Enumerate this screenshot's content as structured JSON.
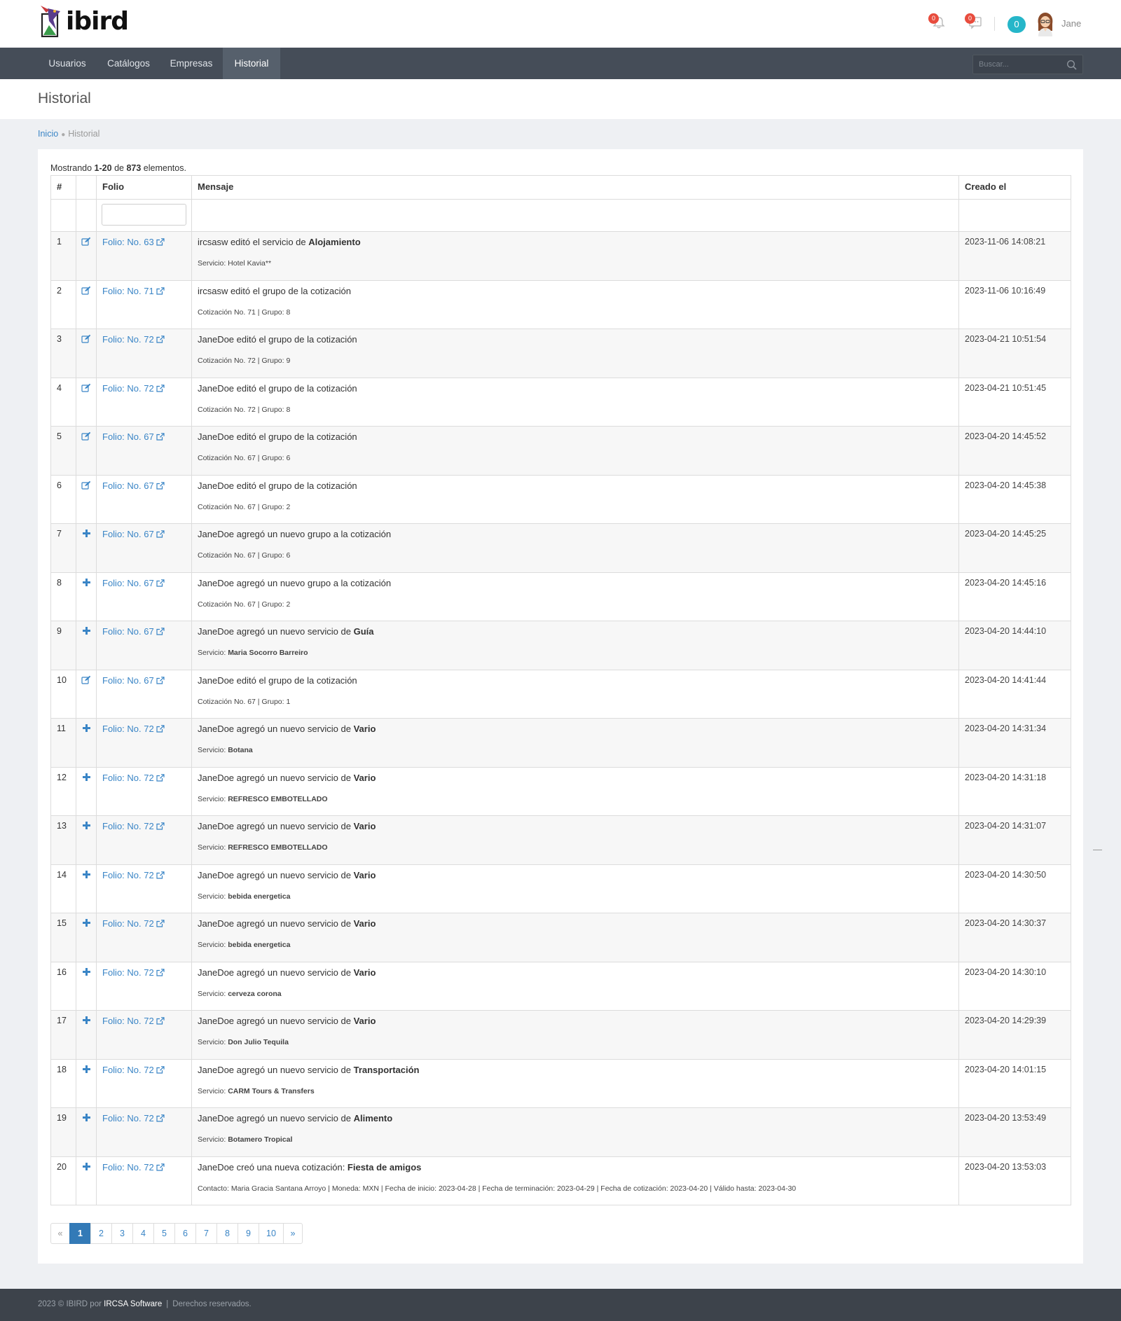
{
  "brand": {
    "logo_text": "ibird"
  },
  "header": {
    "notifications_count": "0",
    "messages_count": "0",
    "counter_badge": "0",
    "user_name": "Jane"
  },
  "nav": {
    "items": [
      {
        "label": "Usuarios"
      },
      {
        "label": "Catálogos"
      },
      {
        "label": "Empresas"
      },
      {
        "label": "Historial",
        "active": true
      }
    ],
    "search_placeholder": "Buscar..."
  },
  "page": {
    "title": "Historial",
    "breadcrumb": {
      "home": "Inicio",
      "current": "Historial"
    }
  },
  "summary": {
    "prefix": "Mostrando",
    "range": "1-20",
    "of": "de",
    "total": "873",
    "suffix": "elementos."
  },
  "table": {
    "headers": {
      "num": "#",
      "action": "",
      "folio": "Folio",
      "message": "Mensaje",
      "created": "Creado el"
    },
    "filter_folio_value": "",
    "rows": [
      {
        "n": "1",
        "icon": "edit-icon",
        "folio": "Folio: No. 63",
        "msg_a": "ircsasw editó el servicio de ",
        "msg_b": "Alojamiento",
        "sub_a": "Servicio: Hotel Kavia**",
        "sub_b": "",
        "date": "2023-11-06 14:08:21"
      },
      {
        "n": "2",
        "icon": "edit-icon",
        "folio": "Folio: No. 71",
        "msg_a": "ircsasw editó el grupo de la cotización",
        "msg_b": "",
        "sub_a": "Cotización No. 71 | Grupo: 8",
        "sub_b": "",
        "date": "2023-11-06 10:16:49"
      },
      {
        "n": "3",
        "icon": "edit-icon",
        "folio": "Folio: No. 72",
        "msg_a": "JaneDoe editó el grupo de la cotización",
        "msg_b": "",
        "sub_a": "Cotización No. 72 | Grupo: 9",
        "sub_b": "",
        "date": "2023-04-21 10:51:54"
      },
      {
        "n": "4",
        "icon": "edit-icon",
        "folio": "Folio: No. 72",
        "msg_a": "JaneDoe editó el grupo de la cotización",
        "msg_b": "",
        "sub_a": "Cotización No. 72 | Grupo: 8",
        "sub_b": "",
        "date": "2023-04-21 10:51:45"
      },
      {
        "n": "5",
        "icon": "edit-icon",
        "folio": "Folio: No. 67",
        "msg_a": "JaneDoe editó el grupo de la cotización",
        "msg_b": "",
        "sub_a": "Cotización No. 67 | Grupo: 6",
        "sub_b": "",
        "date": "2023-04-20 14:45:52"
      },
      {
        "n": "6",
        "icon": "edit-icon",
        "folio": "Folio: No. 67",
        "msg_a": "JaneDoe editó el grupo de la cotización",
        "msg_b": "",
        "sub_a": "Cotización No. 67 | Grupo: 2",
        "sub_b": "",
        "date": "2023-04-20 14:45:38"
      },
      {
        "n": "7",
        "icon": "plus-icon",
        "folio": "Folio: No. 67",
        "msg_a": "JaneDoe agregó un nuevo grupo a la cotización",
        "msg_b": "",
        "sub_a": "Cotización No. 67 | Grupo: 6",
        "sub_b": "",
        "date": "2023-04-20 14:45:25"
      },
      {
        "n": "8",
        "icon": "plus-icon",
        "folio": "Folio: No. 67",
        "msg_a": "JaneDoe agregó un nuevo grupo a la cotización",
        "msg_b": "",
        "sub_a": "Cotización No. 67 | Grupo: 2",
        "sub_b": "",
        "date": "2023-04-20 14:45:16"
      },
      {
        "n": "9",
        "icon": "plus-icon",
        "folio": "Folio: No. 67",
        "msg_a": "JaneDoe agregó un nuevo servicio de ",
        "msg_b": "Guía",
        "sub_a": "Servicio: ",
        "sub_b": "Maria Socorro Barreiro",
        "date": "2023-04-20 14:44:10"
      },
      {
        "n": "10",
        "icon": "edit-icon",
        "folio": "Folio: No. 67",
        "msg_a": "JaneDoe editó el grupo de la cotización",
        "msg_b": "",
        "sub_a": "Cotización No. 67 | Grupo: 1",
        "sub_b": "",
        "date": "2023-04-20 14:41:44"
      },
      {
        "n": "11",
        "icon": "plus-icon",
        "folio": "Folio: No. 72",
        "msg_a": "JaneDoe agregó un nuevo servicio de ",
        "msg_b": "Vario",
        "sub_a": "Servicio: ",
        "sub_b": "Botana",
        "date": "2023-04-20 14:31:34"
      },
      {
        "n": "12",
        "icon": "plus-icon",
        "folio": "Folio: No. 72",
        "msg_a": "JaneDoe agregó un nuevo servicio de ",
        "msg_b": "Vario",
        "sub_a": "Servicio: ",
        "sub_b": "REFRESCO EMBOTELLADO",
        "date": "2023-04-20 14:31:18"
      },
      {
        "n": "13",
        "icon": "plus-icon",
        "folio": "Folio: No. 72",
        "msg_a": "JaneDoe agregó un nuevo servicio de ",
        "msg_b": "Vario",
        "sub_a": "Servicio: ",
        "sub_b": "REFRESCO EMBOTELLADO",
        "date": "2023-04-20 14:31:07"
      },
      {
        "n": "14",
        "icon": "plus-icon",
        "folio": "Folio: No. 72",
        "msg_a": "JaneDoe agregó un nuevo servicio de ",
        "msg_b": "Vario",
        "sub_a": "Servicio: ",
        "sub_b": "bebida energetica",
        "date": "2023-04-20 14:30:50"
      },
      {
        "n": "15",
        "icon": "plus-icon",
        "folio": "Folio: No. 72",
        "msg_a": "JaneDoe agregó un nuevo servicio de ",
        "msg_b": "Vario",
        "sub_a": "Servicio: ",
        "sub_b": "bebida energetica",
        "date": "2023-04-20 14:30:37"
      },
      {
        "n": "16",
        "icon": "plus-icon",
        "folio": "Folio: No. 72",
        "msg_a": "JaneDoe agregó un nuevo servicio de ",
        "msg_b": "Vario",
        "sub_a": "Servicio: ",
        "sub_b": "cerveza corona",
        "date": "2023-04-20 14:30:10"
      },
      {
        "n": "17",
        "icon": "plus-icon",
        "folio": "Folio: No. 72",
        "msg_a": "JaneDoe agregó un nuevo servicio de ",
        "msg_b": "Vario",
        "sub_a": "Servicio: ",
        "sub_b": "Don Julio Tequila",
        "date": "2023-04-20 14:29:39"
      },
      {
        "n": "18",
        "icon": "plus-icon",
        "folio": "Folio: No. 72",
        "msg_a": "JaneDoe agregó un nuevo servicio de ",
        "msg_b": "Transportación",
        "sub_a": "Servicio: ",
        "sub_b": "CARM Tours & Transfers",
        "date": "2023-04-20 14:01:15"
      },
      {
        "n": "19",
        "icon": "plus-icon",
        "folio": "Folio: No. 72",
        "msg_a": "JaneDoe agregó un nuevo servicio de ",
        "msg_b": "Alimento",
        "sub_a": "Servicio: ",
        "sub_b": "Botamero Tropical",
        "date": "2023-04-20 13:53:49"
      },
      {
        "n": "20",
        "icon": "plus-icon",
        "folio": "Folio: No. 72",
        "msg_a": "JaneDoe creó una nueva cotización: ",
        "msg_b": "Fiesta de amigos",
        "sub_a": "Contacto: Maria Gracia Santana Arroyo | Moneda: MXN | Fecha de inicio: 2023-04-28 | Fecha de terminación: 2023-04-29 | Fecha de cotización: 2023-04-20 | Válido hasta: 2023-04-30",
        "sub_b": "",
        "date": "2023-04-20 13:53:03"
      }
    ]
  },
  "pagination": {
    "prev": "«",
    "pages": [
      "1",
      "2",
      "3",
      "4",
      "5",
      "6",
      "7",
      "8",
      "9",
      "10"
    ],
    "active": "1",
    "next": "»"
  },
  "footer": {
    "copyright": "2023 © IBIRD por ",
    "company": "IRCSA Software",
    "separator": "|",
    "rights": "Derechos reservados."
  },
  "colors": {
    "nav_bg": "#454d58",
    "link": "#3a85c6",
    "active_page": "#337ab7",
    "badge_red": "#e84c3d",
    "badge_teal": "#26b6c9",
    "footer_bg": "#3d434b"
  }
}
